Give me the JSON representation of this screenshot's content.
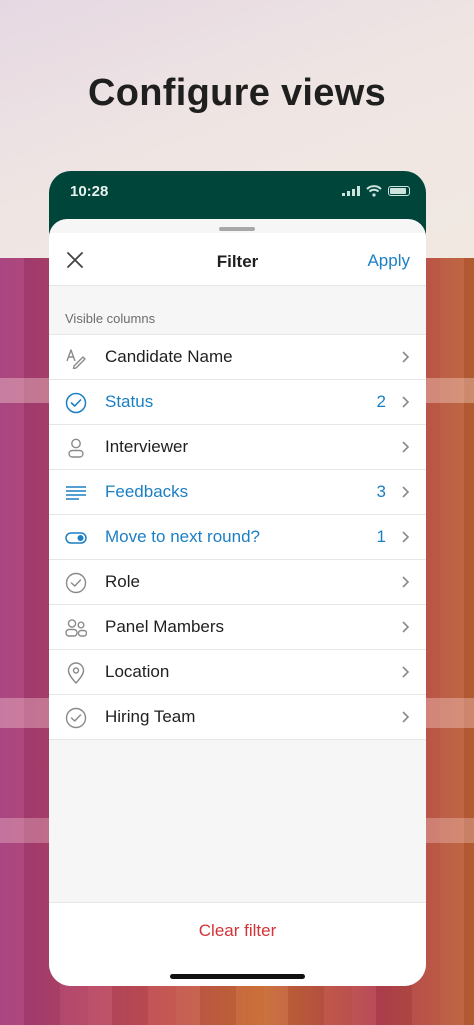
{
  "headline": "Configure views",
  "status_bar": {
    "time": "10:28"
  },
  "sheet": {
    "title": "Filter",
    "apply_label": "Apply",
    "section_label": "Visible columns",
    "clear_label": "Clear filter"
  },
  "columns": [
    {
      "label": "Candidate Name",
      "icon": "text-field-icon",
      "count": "",
      "active": false
    },
    {
      "label": "Status",
      "icon": "check-circle-icon",
      "count": "2",
      "active": true
    },
    {
      "label": "Interviewer",
      "icon": "person-icon",
      "count": "",
      "active": false
    },
    {
      "label": "Feedbacks",
      "icon": "multiline-text-icon",
      "count": "3",
      "active": true
    },
    {
      "label": "Move to next round?",
      "icon": "toggle-icon",
      "count": "1",
      "active": true
    },
    {
      "label": "Role",
      "icon": "check-circle-icon",
      "count": "",
      "active": false
    },
    {
      "label": "Panel Mambers",
      "icon": "people-icon",
      "count": "",
      "active": false
    },
    {
      "label": "Location",
      "icon": "location-pin-icon",
      "count": "",
      "active": false
    },
    {
      "label": "Hiring Team",
      "icon": "check-circle-icon",
      "count": "",
      "active": false
    }
  ],
  "colors": {
    "accent": "#1b7fc4",
    "danger": "#d13438",
    "phone_header": "#00453a",
    "icon_gray": "#8a8a8a"
  }
}
